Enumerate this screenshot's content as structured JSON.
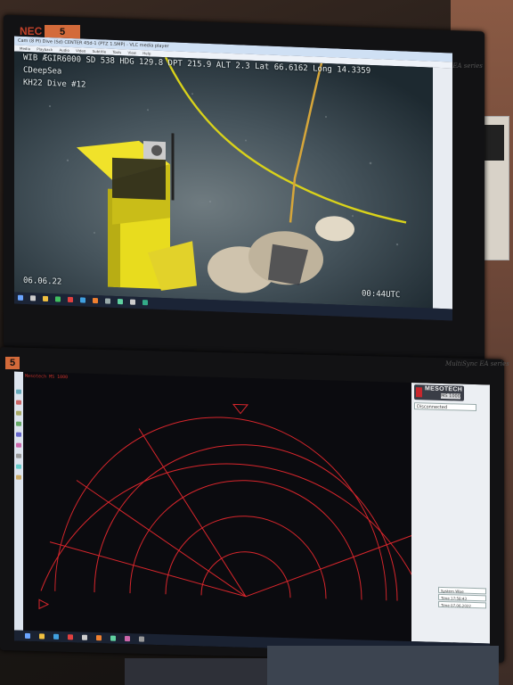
{
  "top_monitor": {
    "tag": "5",
    "brand": "MultiSync EA series",
    "window_title": "Cam (8 Pl) Dive (Sd) CENTER 45d-1 (PTZ 1.5MP) - VLC media player",
    "menu": [
      "Media",
      "Playback",
      "Audio",
      "Video",
      "Subtitle",
      "Tools",
      "View",
      "Help"
    ],
    "overlay": {
      "telemetry": "WIB ÆGIR6000  SD  538  HDG  129.8  DPT  215.9  ALT  2.3  Lat  66.6162  Long  14.3359",
      "org": "CDeepSea",
      "dive": "KH22 Dive #12",
      "date": "06.06.22",
      "time": "00:44UTC"
    }
  },
  "bottom_monitor": {
    "tag": "5",
    "brand": "MultiSync EA series",
    "sonar_header": "Mesotech MS 1000",
    "side_panel": {
      "logo": "MESOTECH",
      "model": "MS 1000",
      "status": "Disconnected",
      "system": "System Wise",
      "time1": "Time 17:58:43",
      "time2": "Time 07.06.2022"
    }
  },
  "colors": {
    "sonar_grid": "#d8262c",
    "equipment": "#e8dc1e",
    "rope": "#d6a63a",
    "cable": "#d9d21a"
  }
}
